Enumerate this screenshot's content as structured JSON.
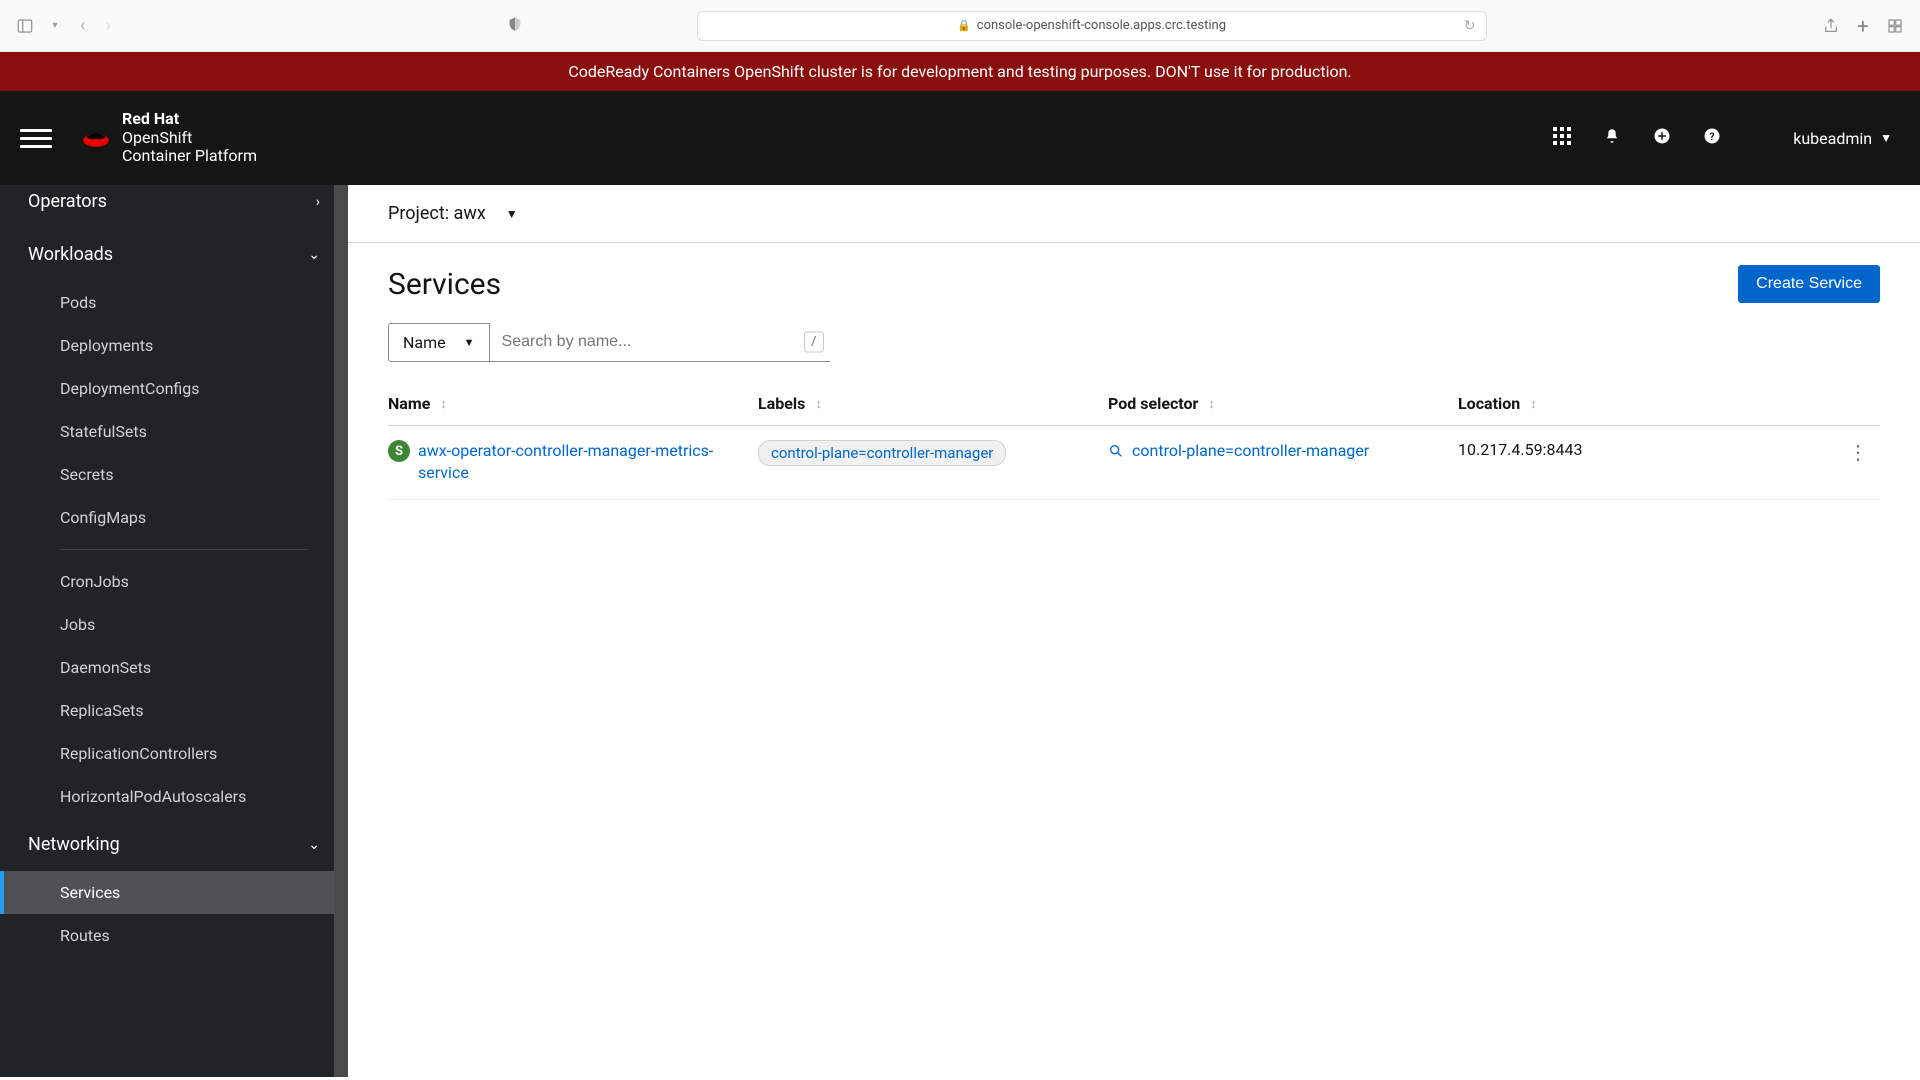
{
  "browser": {
    "url": "console-openshift-console.apps.crc.testing"
  },
  "banner": {
    "text": "CodeReady Containers OpenShift cluster is for development and testing purposes. DON'T use it for production."
  },
  "brand": {
    "line1": "Red Hat",
    "line2": "OpenShift",
    "line3": "Container Platform"
  },
  "user": "kubeadmin",
  "sidebar": {
    "operators": {
      "label": "Operators"
    },
    "workloads": {
      "label": "Workloads",
      "items": [
        "Pods",
        "Deployments",
        "DeploymentConfigs",
        "StatefulSets",
        "Secrets",
        "ConfigMaps",
        "CronJobs",
        "Jobs",
        "DaemonSets",
        "ReplicaSets",
        "ReplicationControllers",
        "HorizontalPodAutoscalers"
      ]
    },
    "networking": {
      "label": "Networking",
      "items": [
        "Services",
        "Routes"
      ]
    }
  },
  "project": {
    "label": "Project:",
    "value": "awx"
  },
  "page": {
    "title": "Services",
    "create_button": "Create Service"
  },
  "filter": {
    "dropdown": "Name",
    "placeholder": "Search by name...",
    "shortcut": "/"
  },
  "columns": {
    "name": "Name",
    "labels": "Labels",
    "pod_selector": "Pod selector",
    "location": "Location"
  },
  "rows": [
    {
      "badge": "S",
      "name": "awx-operator-controller-manager-metrics-service",
      "label": "control-plane=controller-manager",
      "selector": "control-plane=controller-manager",
      "location": "10.217.4.59:8443"
    }
  ]
}
